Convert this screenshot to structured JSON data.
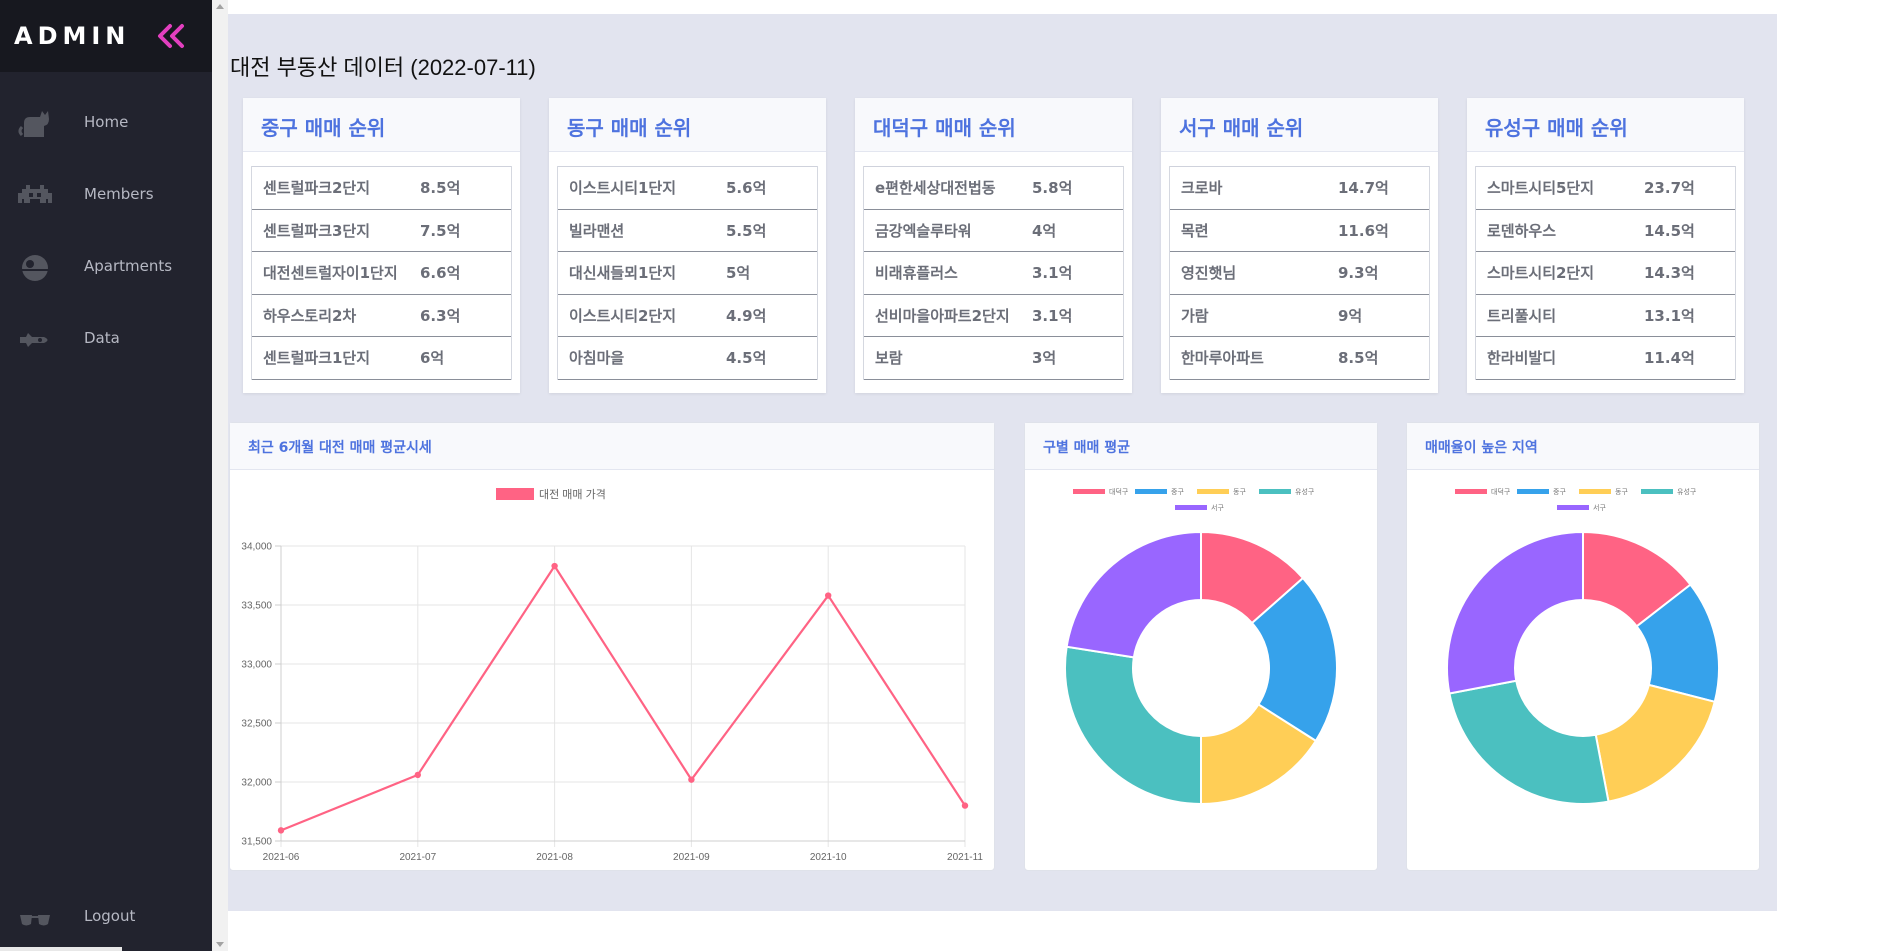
{
  "sidebar": {
    "brand": "ADMIN",
    "items": [
      {
        "label": "Home",
        "icon": "cat-icon"
      },
      {
        "label": "Members",
        "icon": "space-invader-icon"
      },
      {
        "label": "Apartments",
        "icon": "death-star-icon"
      },
      {
        "label": "Data",
        "icon": "spaceship-icon"
      }
    ],
    "logout": {
      "label": "Logout",
      "icon": "glasses-icon"
    }
  },
  "page": {
    "title": "대전 부동산 데이터 (2022-07-11)"
  },
  "rankings": [
    {
      "title": "중구 매매 순위",
      "rows": [
        {
          "name": "센트럴파크2단지",
          "price": "8.5억"
        },
        {
          "name": "센트럴파크3단지",
          "price": "7.5억"
        },
        {
          "name": "대전센트럴자이1단지",
          "price": "6.6억"
        },
        {
          "name": "하우스토리2차",
          "price": "6.3억"
        },
        {
          "name": "센트럴파크1단지",
          "price": "6억"
        }
      ]
    },
    {
      "title": "동구 매매 순위",
      "rows": [
        {
          "name": "이스트시티1단지",
          "price": "5.6억"
        },
        {
          "name": "빌라맨션",
          "price": "5.5억"
        },
        {
          "name": "대신새들뫼1단지",
          "price": "5억"
        },
        {
          "name": "이스트시티2단지",
          "price": "4.9억"
        },
        {
          "name": "아침마을",
          "price": "4.5억"
        }
      ]
    },
    {
      "title": "대덕구 매매 순위",
      "rows": [
        {
          "name": "e편한세상대전법동",
          "price": "5.8억"
        },
        {
          "name": "금강엑슬루타워",
          "price": "4억"
        },
        {
          "name": "비래휴플러스",
          "price": "3.1억"
        },
        {
          "name": "선비마을아파트2단지",
          "price": "3.1억"
        },
        {
          "name": "보람",
          "price": "3억"
        }
      ]
    },
    {
      "title": "서구 매매 순위",
      "rows": [
        {
          "name": "크로바",
          "price": "14.7억"
        },
        {
          "name": "목련",
          "price": "11.6억"
        },
        {
          "name": "영진햇님",
          "price": "9.3억"
        },
        {
          "name": "가람",
          "price": "9억"
        },
        {
          "name": "한마루아파트",
          "price": "8.5억"
        }
      ]
    },
    {
      "title": "유성구 매매 순위",
      "rows": [
        {
          "name": "스마트시티5단지",
          "price": "23.7억"
        },
        {
          "name": "로덴하우스",
          "price": "14.5억"
        },
        {
          "name": "스마트시티2단지",
          "price": "14.3억"
        },
        {
          "name": "트리풀시티",
          "price": "13.1억"
        },
        {
          "name": "한라비발디",
          "price": "11.4억"
        }
      ]
    }
  ],
  "panels": {
    "line": {
      "title": "최근 6개월 대전 매매 평균시세"
    },
    "donut1": {
      "title": "구별 매매 평균"
    },
    "donut2": {
      "title": "매매율이 높은 지역"
    }
  },
  "colors": {
    "accent": "#4e73df",
    "line": "#ff6384",
    "sidebar": "#22232e",
    "main_bg": "#e2e4ef"
  },
  "chart_data": [
    {
      "type": "line",
      "x": [
        "2021-06",
        "2021-07",
        "2021-08",
        "2021-09",
        "2021-10",
        "2021-11"
      ],
      "series": [
        {
          "name": "대전 매매 가격",
          "values": [
            31590,
            32060,
            33830,
            32020,
            33580,
            31800
          ],
          "color": "#ff6384"
        }
      ],
      "yticks": [
        "34,000",
        "33,500",
        "33,000",
        "32,500",
        "32,000",
        "31,500"
      ],
      "ylim": [
        31500,
        34000
      ],
      "grid": true,
      "legend": "top"
    },
    {
      "type": "pie",
      "labels": [
        "대덕구",
        "중구",
        "동구",
        "유성구",
        "서구"
      ],
      "values": [
        13.5,
        20.5,
        16.0,
        27.5,
        22.5
      ],
      "colors": [
        "#ff6384",
        "#36a2eb",
        "#ffce56",
        "#4bc0c0",
        "#9966ff"
      ],
      "legend": "top"
    },
    {
      "type": "pie",
      "labels": [
        "대덕구",
        "중구",
        "동구",
        "유성구",
        "서구"
      ],
      "values": [
        14.5,
        14.5,
        18.0,
        25.0,
        28.0
      ],
      "colors": [
        "#ff6384",
        "#36a2eb",
        "#ffce56",
        "#4bc0c0",
        "#9966ff"
      ],
      "legend": "top"
    }
  ]
}
